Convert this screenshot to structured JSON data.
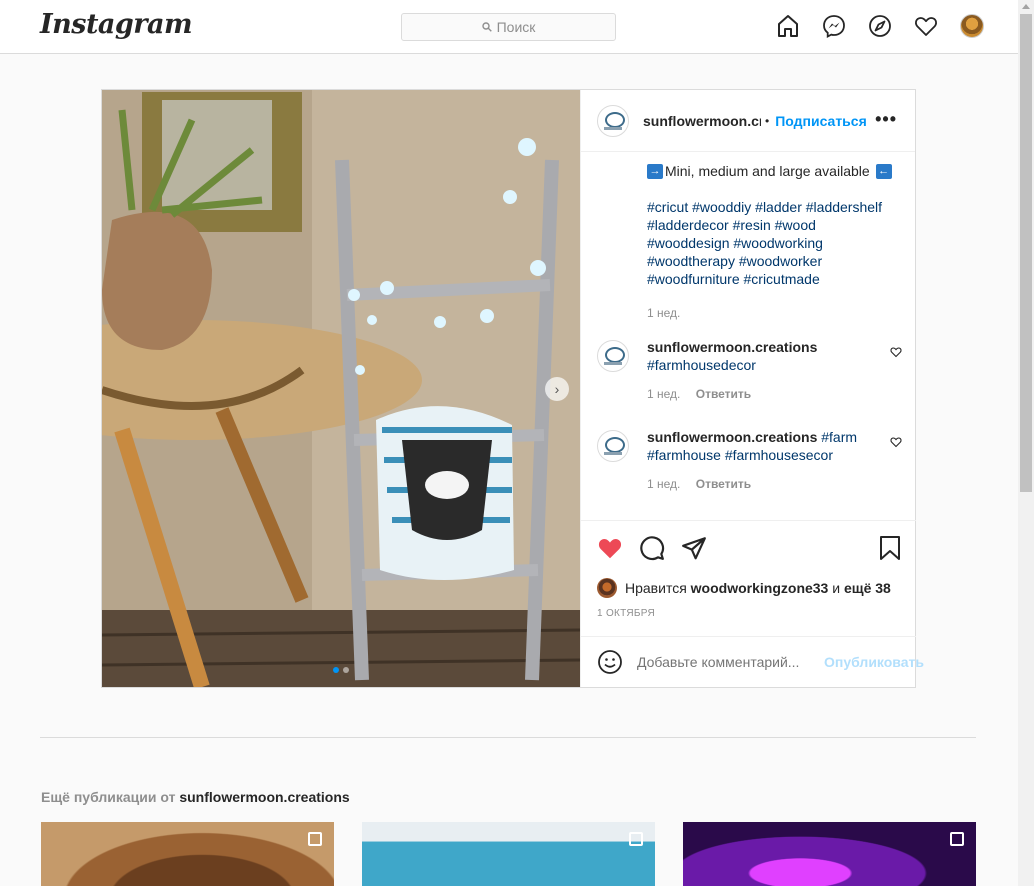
{
  "nav": {
    "logo": "Instagram",
    "search_placeholder": "Поиск"
  },
  "post": {
    "username": "sunflowermoon.creations",
    "username_visible": "sunflowermoon.cre",
    "dot": "•",
    "follow_label": "Подписаться",
    "more_label": "•••",
    "next_label": "›",
    "caption": {
      "line1": "Mini, medium and large available",
      "arrow_left": "→",
      "arrow_right": "←",
      "tags": "#cricut #wooddiy #ladder #laddershelf #ladderdecor #resin #wood #wooddesign #woodworking #woodtherapy #woodworker #woodfurniture #cricutmade",
      "time": "1 нед."
    },
    "comments": [
      {
        "user": "sunflowermoon.creations",
        "text": "#farmhousedecor",
        "time": "1 нед.",
        "reply": "Ответить"
      },
      {
        "user": "sunflowermoon.creations",
        "text": "#farm #farmhouse #farmhousesecor",
        "time": "1 нед.",
        "reply": "Ответить"
      }
    ],
    "likes": {
      "prefix": "Нравится",
      "user": "woodworkingzone33",
      "and": "и",
      "others": "ещё 38"
    },
    "date": "1 ОКТЯБРЯ",
    "add_comment_placeholder": "Добавьте комментарий...",
    "publish_label": "Опубликовать",
    "carousel": {
      "current": 1,
      "total": 2
    }
  },
  "more_section": {
    "prefix": "Ещё публикации от",
    "user": "sunflowermoon.creations"
  },
  "colors": {
    "like_red": "#ed4956",
    "link_blue": "#0095f6",
    "hashtag": "#00376b",
    "muted": "#8e8e8e"
  }
}
